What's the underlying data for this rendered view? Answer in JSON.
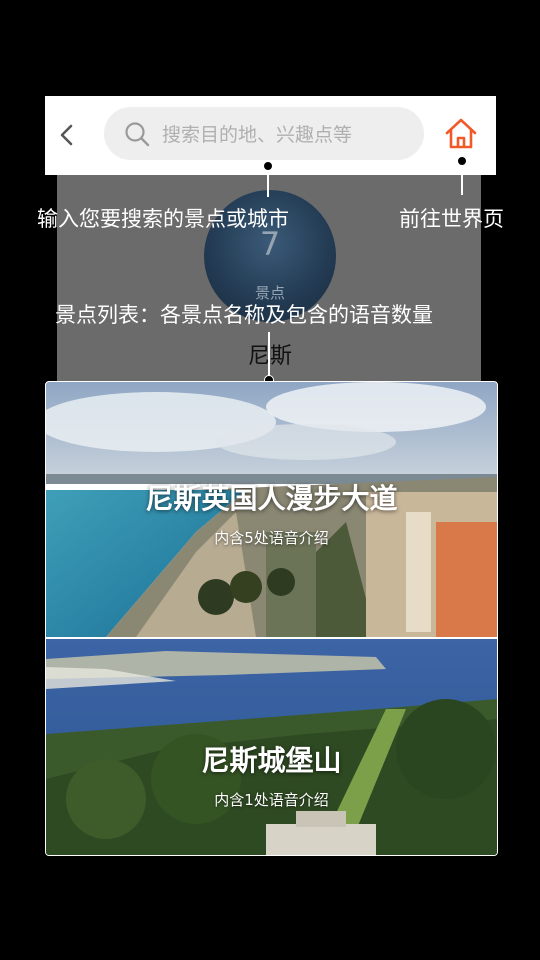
{
  "search": {
    "placeholder": "搜索目的地、兴趣点等"
  },
  "city": {
    "name": "尼斯",
    "count": "7",
    "unit": "景点"
  },
  "annotations": {
    "search_hint": "输入您要搜索的景点或城市",
    "home_hint": "前往世界页",
    "list_hint": "景点列表：各景点名称及包含的语音数量"
  },
  "spots": [
    {
      "title": "尼斯英国人漫步大道",
      "subtitle": "内含5处语音介绍"
    },
    {
      "title": "尼斯城堡山",
      "subtitle": "内含1处语音介绍"
    }
  ],
  "colors": {
    "accent": "#f05a28",
    "overlay": "#000000"
  }
}
